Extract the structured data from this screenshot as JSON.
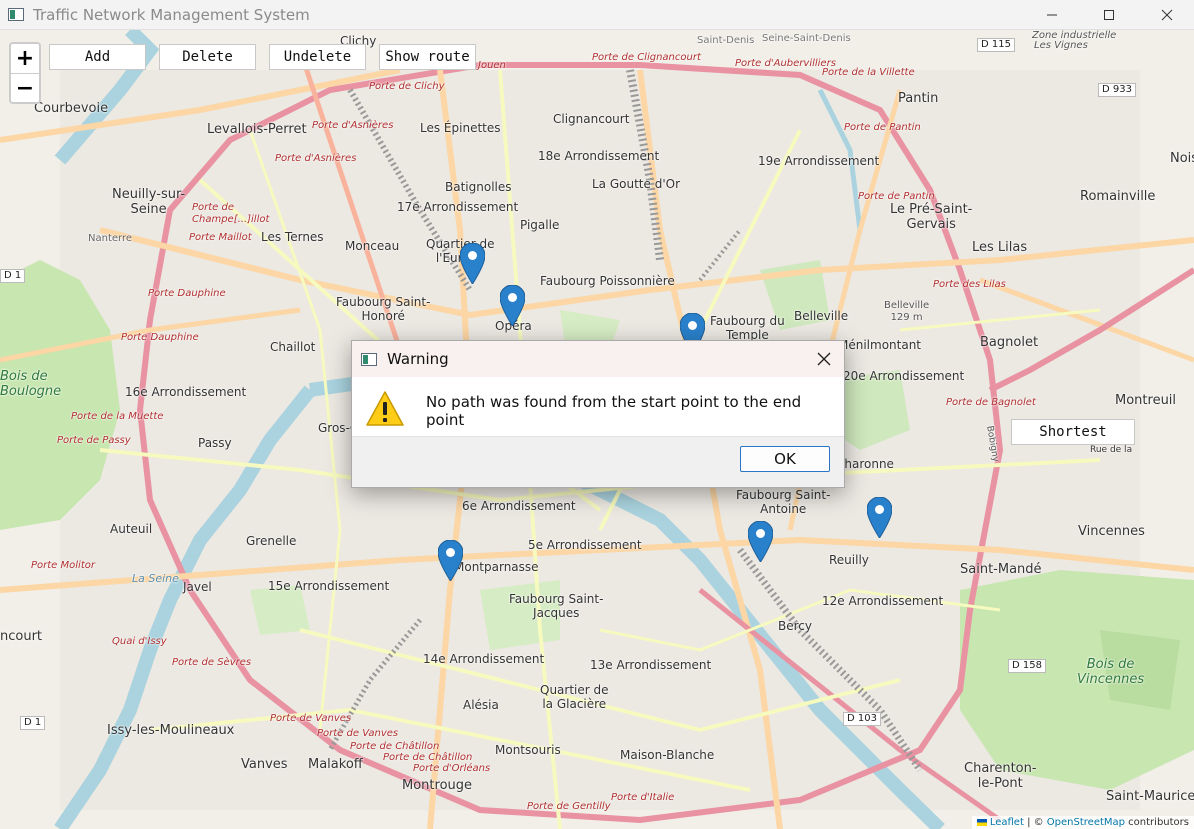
{
  "window": {
    "title": "Traffic Network Management System"
  },
  "toolbar": {
    "zoom_in": "+",
    "zoom_out": "−",
    "add": "Add",
    "delete": "Delete",
    "undelete": "Undelete",
    "show_route": "Show route",
    "shortest": "Shortest"
  },
  "map": {
    "districts": {
      "clichy": "Clichy",
      "saint_denis": "Saint-Denis",
      "seine_saint_denis": "Seine-Saint-Denis",
      "zone_industrielle": "Zone industrielle",
      "les_vignes": "Les Vignes",
      "courbevoie": "Courbevoie",
      "levallois": "Levallois-Perret",
      "epinettes": "Les Épinettes",
      "clignancourt": "Clignancourt",
      "pantin": "Pantin",
      "arr18": "18e Arrondissement",
      "arr19": "19e Arrondissement",
      "noisy": "Noisy",
      "batignolles": "Batignolles",
      "goutte_dor": "La Goutte d'Or",
      "neuilly": "Neuilly-sur-\nSeine",
      "arr17": "17e Arrondissement",
      "pigalle": "Pigalle",
      "pre_saint_gervais": "Le Pré-Saint-\nGervais",
      "romainville": "Romainville",
      "ternes": "Les Ternes",
      "monceau": "Monceau",
      "quartier_europe": "Quartier de\nl'Europe",
      "lilas": "Les Lilas",
      "faubourg_poissonniere": "Faubourg Poissonnière",
      "faubourg_saint_honore": "Faubourg Saint-\nHonoré",
      "opera": "Opéra",
      "faubourg_temple": "Faubourg du\nTemple",
      "belleville": "Belleville",
      "belleville_alt": "Belleville\n129 m",
      "chaillot": "Chaillot",
      "menilmontant": "Ménilmontant",
      "bagnolet": "Bagnolet",
      "bois_boulogne": "Bois de\nBoulogne",
      "arr16": "16e Arrondissement",
      "arr20": "20e Arrondissement",
      "montreuil": "Montreuil",
      "gros_caillou": "Gros-Caillou",
      "passy": "Passy",
      "charonne": "Charonne",
      "faubourg_saint_antoine": "Faubourg Saint-\nAntoine",
      "arr6": "6e Arrondissement",
      "auteuil": "Auteuil",
      "vincennes": "Vincennes",
      "grenelle": "Grenelle",
      "arr5": "5e Arrondissement",
      "reuilly": "Reuilly",
      "montparnasse": "Montparnasse",
      "saint_mande": "Saint-Mandé",
      "javel": "Javel",
      "arr15": "15e Arrondissement",
      "faubourg_saint_jacques": "Faubourg Saint-\nJacques",
      "arr12": "12e Arrondissement",
      "bercy": "Bercy",
      "boulogne_court": "ncourt",
      "arr14": "14e Arrondissement",
      "arr13": "13e Arrondissement",
      "bois_vincennes": "Bois de\nVincennes",
      "quartier_glaciere": "Quartier de\nla Glacière",
      "alesia": "Alésia",
      "issy": "Issy-les-Moulineaux",
      "montsouris": "Montsouris",
      "maison_blanche": "Maison-Blanche",
      "vanves": "Vanves",
      "malakoff": "Malakoff",
      "charenton": "Charenton-\nle-Pont",
      "montrouge": "Montrouge",
      "saint_maurice": "Saint-Maurice",
      "la_seine": "La Seine",
      "nanterre": "Nanterre",
      "bobigny": "Bobigny",
      "rue_de_la": "Rue de la"
    },
    "gates": {
      "porte_clignancourt": "Porte de Clignancourt",
      "porte_aubervilliers": "Porte d'Aubervilliers",
      "porte_villette": "Porte de la Villette",
      "porte_clichy": "Porte de Clichy",
      "porte_asnieres_1": "Porte d'Asnières",
      "porte_asnieres_2": "Porte d'Asnières",
      "porte_pantin_1": "Porte de Pantin",
      "porte_pantin_2": "Porte de Pantin",
      "porte_champerret": "Porte de\nChampe[...]illot",
      "porte_maillot": "Porte Maillot",
      "porte_lilas": "Porte des Lilas",
      "porte_dauphine_1": "Porte Dauphine",
      "porte_dauphine_2": "Porte Dauphine",
      "porte_bagnolet": "Porte de Bagnolet",
      "porte_muette": "Porte de la Muette",
      "porte_passy": "Porte de Passy",
      "porte_molitor": "Porte Molitor",
      "quai_issy": "Quai d'Issy",
      "porte_sevres": "Porte de Sèvres",
      "porte_vanves_1": "Porte de Vanves",
      "porte_vanves_2": "Porte de Vanves",
      "porte_chatillon_1": "Porte de Châtillon",
      "porte_chatillon_2": "Porte de Châtillon",
      "porte_orleans": "Porte d'Orléans",
      "porte_gentilly": "Porte de Gentilly",
      "porte_italie": "Porte d'Italie",
      "porte_jouen": "Jouen"
    },
    "roads": {
      "d115": "D 115",
      "d933": "D 933",
      "d1_left": "D 1",
      "d1_bottom": "D 1",
      "d158": "D 158",
      "d103": "D 103"
    },
    "markers": [
      "marker-1",
      "marker-2",
      "marker-3",
      "marker-4",
      "marker-5",
      "marker-6"
    ],
    "attribution": {
      "leaflet": "Leaflet",
      "sep": " | © ",
      "osm": "OpenStreetMap",
      "contrib": " contributors"
    }
  },
  "dialog": {
    "title": "Warning",
    "message": "No path was found from the start point to the end point",
    "ok": "OK",
    "icon": "warning-icon"
  },
  "colors": {
    "marker_blue": "#2a81cb",
    "ok_border": "#2a76c6",
    "dialog_title_bg": "#f9f0f0"
  }
}
